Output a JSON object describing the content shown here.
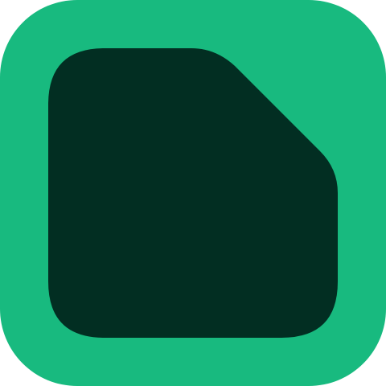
{
  "icon": {
    "semantic": "file-document-icon",
    "colors": {
      "background": "#18BA7F",
      "glyph": "#022E22"
    }
  }
}
